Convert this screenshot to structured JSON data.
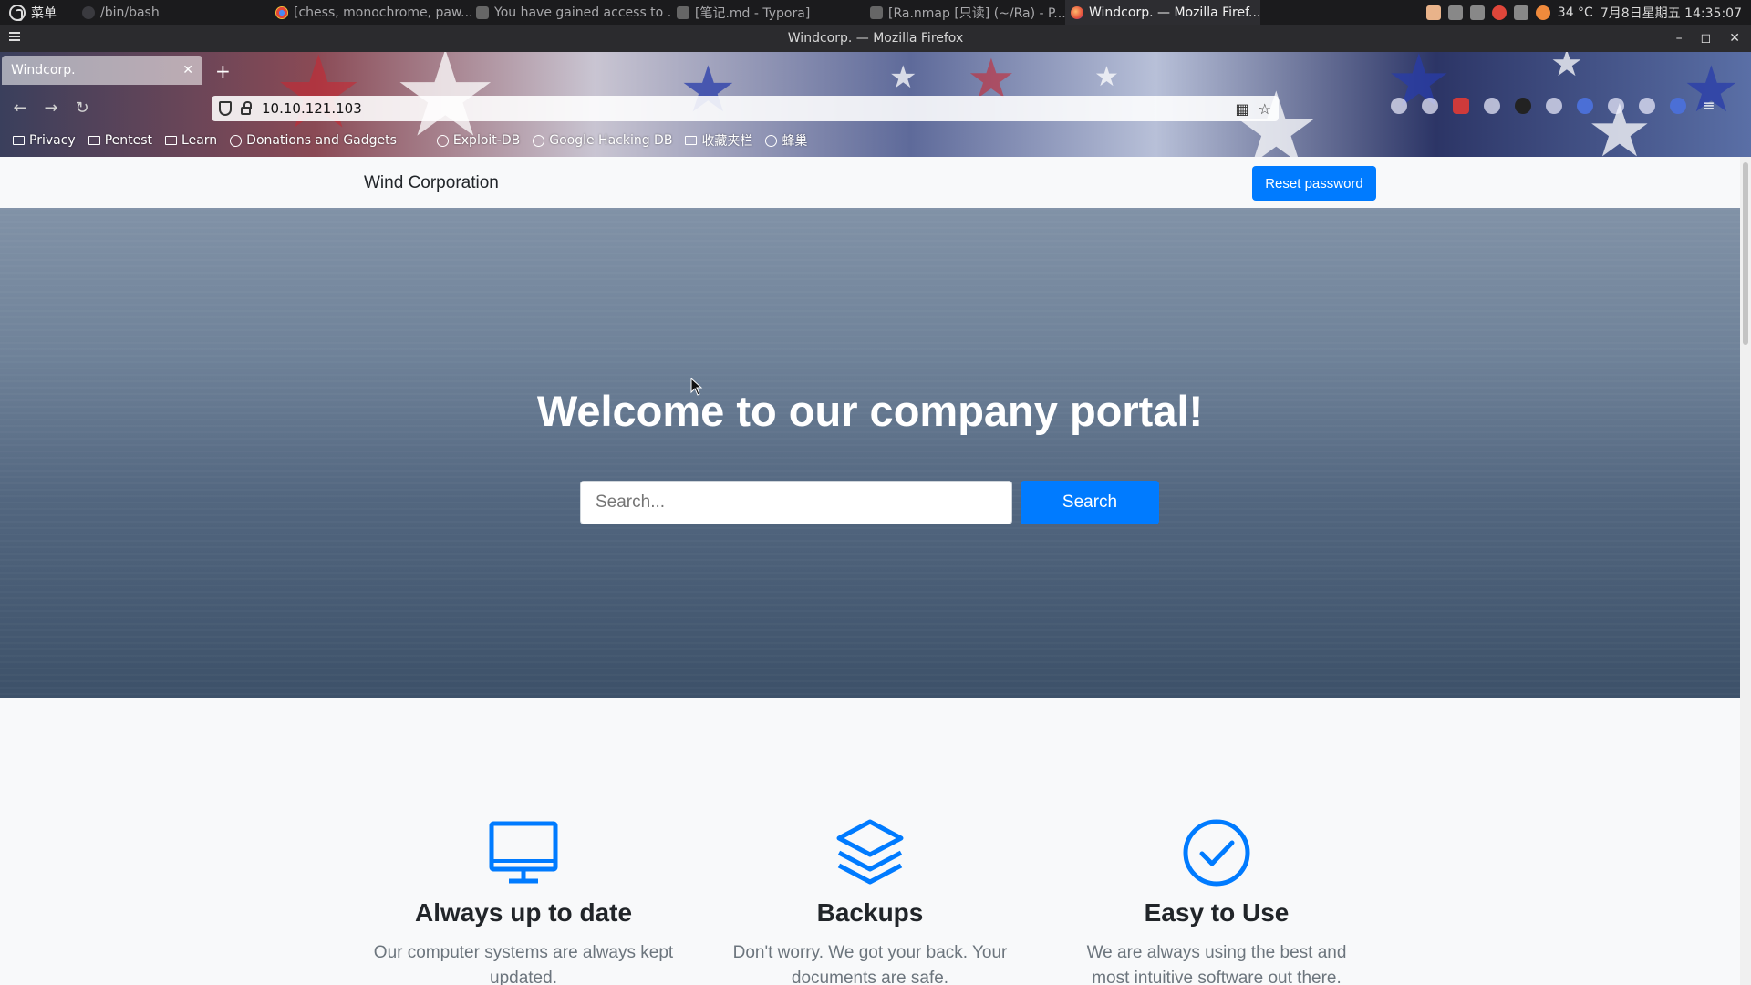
{
  "system_panel": {
    "menu_label": "菜单",
    "tasks": [
      {
        "label": "/bin/bash",
        "icon": "terminal-icon"
      },
      {
        "label": "[chess, monochrome, paw...",
        "icon": "chrome-icon"
      },
      {
        "label": "You have gained access to ...",
        "icon": "typora-icon"
      },
      {
        "label": "[笔记.md - Typora]",
        "icon": "typora-icon"
      },
      {
        "label": "[Ra.nmap [只读] (~/Ra) - P...",
        "icon": "editor-icon"
      },
      {
        "label": "Windcorp. — Mozilla Firef...",
        "icon": "firefox-icon"
      }
    ],
    "temperature": "34 °C",
    "datetime": "7月8日星期五 14:35:07"
  },
  "window": {
    "title": "Windcorp. — Mozilla Firefox"
  },
  "browser": {
    "tab_title": "Windcorp.",
    "url": "10.10.121.103",
    "bookmarks": [
      {
        "label": "Privacy",
        "type": "folder"
      },
      {
        "label": "Pentest",
        "type": "folder"
      },
      {
        "label": "Learn",
        "type": "folder"
      },
      {
        "label": "Donations and Gadgets",
        "type": "site"
      },
      {
        "label": "Exploit-DB",
        "type": "site"
      },
      {
        "label": "Google Hacking DB",
        "type": "site"
      },
      {
        "label": "收藏夹栏",
        "type": "folder"
      },
      {
        "label": "蜂巢",
        "type": "site"
      }
    ]
  },
  "site": {
    "brand": "Wind Corporation",
    "reset_password_label": "Reset password",
    "hero_heading": "Welcome to our company portal!",
    "search_placeholder": "Search...",
    "search_button_label": "Search",
    "features": [
      {
        "icon": "monitor-icon",
        "title": "Always up to date",
        "text": "Our computer systems are always kept updated."
      },
      {
        "icon": "layers-icon",
        "title": "Backups",
        "text": "Don't worry. We got your back. Your documents are safe."
      },
      {
        "icon": "check-circle-icon",
        "title": "Easy to Use",
        "text": "We are always using the best and most intuitive software out there."
      }
    ],
    "accent_color": "#007bff"
  }
}
